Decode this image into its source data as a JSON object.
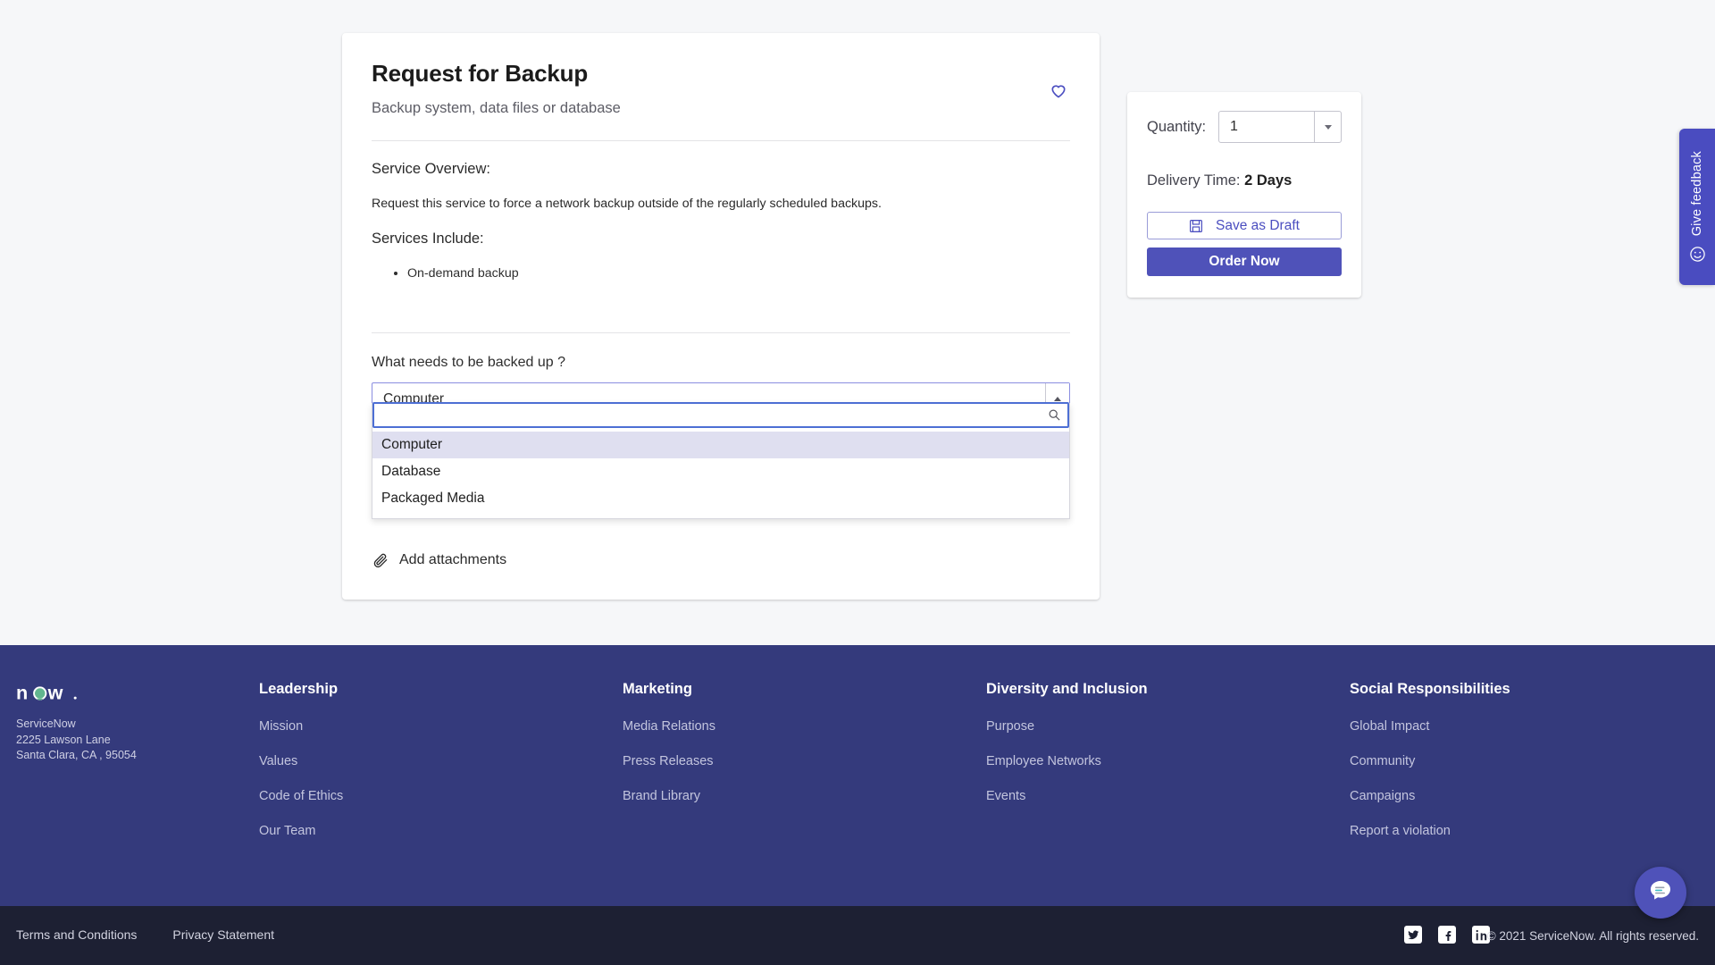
{
  "item": {
    "title": "Request for Backup",
    "subtitle": "Backup system, data files or database",
    "favorite_icon": "heart-icon",
    "overview_heading": "Service Overview:",
    "overview_text": "Request this service to force a network backup outside of the regularly scheduled backups.",
    "services_heading": "Services Include:",
    "services": [
      "On-demand backup"
    ]
  },
  "question": {
    "label": "What needs to be backed up ?",
    "selected_value": "Computer",
    "search_value": "",
    "search_placeholder": "",
    "search_icon": "magnifier-icon",
    "toggle_icon": "caret-up-icon",
    "options": [
      {
        "label": "Computer",
        "selected": true
      },
      {
        "label": "Database",
        "selected": false
      },
      {
        "label": "Packaged Media",
        "selected": false
      }
    ]
  },
  "attachments": {
    "label": "Add attachments",
    "icon": "paperclip-icon"
  },
  "order_panel": {
    "quantity_label": "Quantity:",
    "quantity_value": "1",
    "quantity_toggle_icon": "caret-down-icon",
    "delivery_label": "Delivery Time:",
    "delivery_value": "2 Days",
    "save_draft_label": "Save as Draft",
    "save_draft_icon": "floppy-disk-icon",
    "order_now_label": "Order Now",
    "accent_color": "#4f52b9"
  },
  "feedback_tab": {
    "label": "Give feedback",
    "icon": "smiley-face-icon"
  },
  "footer": {
    "brand": "now",
    "company": "ServiceNow",
    "address_line1": "2225 Lawson Lane",
    "address_line2": "Santa Clara, CA , 95054",
    "background_color": "#343a7c",
    "columns": [
      {
        "title": "Leadership",
        "links": [
          "Mission",
          "Values",
          "Code of Ethics",
          "Our Team"
        ]
      },
      {
        "title": "Marketing",
        "links": [
          "Media Relations",
          "Press Releases",
          "Brand Library"
        ]
      },
      {
        "title": "Diversity and Inclusion",
        "links": [
          "Purpose",
          "Employee Networks",
          "Events"
        ]
      },
      {
        "title": "Social Responsibilities",
        "links": [
          "Global Impact",
          "Community",
          "Campaigns",
          "Report a violation"
        ]
      }
    ]
  },
  "bottom_bar": {
    "background_color": "#1d2033",
    "links": [
      "Terms and Conditions",
      "Privacy Statement"
    ],
    "socials": [
      "twitter-icon",
      "facebook-icon",
      "linkedin-icon"
    ],
    "copyright": "© 2021 ServiceNow. All rights reserved."
  },
  "chat": {
    "icon": "chat-bubble-icon"
  }
}
